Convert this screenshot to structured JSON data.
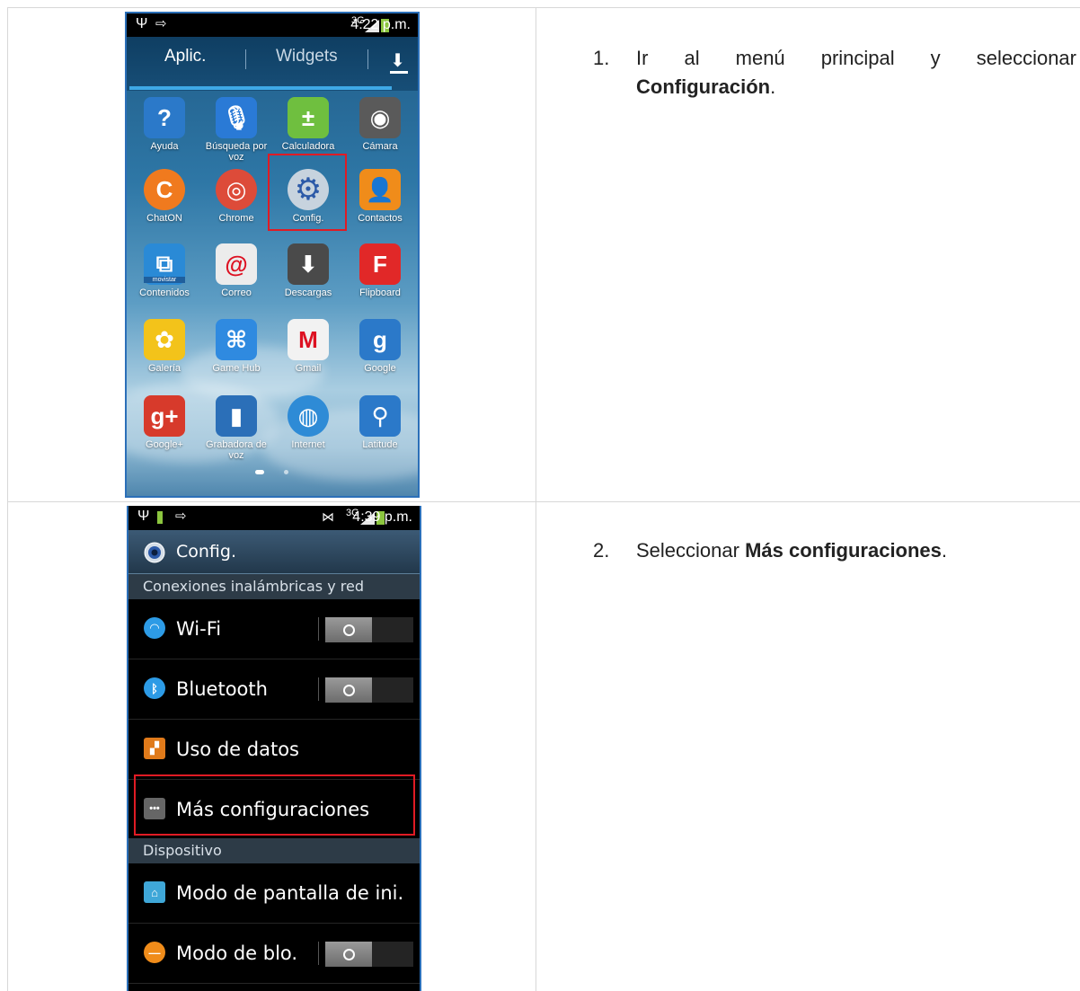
{
  "phone1": {
    "statusbar": {
      "net": "3G",
      "time": "4:22 p.m."
    },
    "tabs": {
      "apps": "Aplic.",
      "widgets": "Widgets"
    },
    "apps": [
      {
        "label": "Ayuda",
        "icon": "help-book-icon"
      },
      {
        "label": "Búsqueda por voz",
        "icon": "microphone-icon"
      },
      {
        "label": "Calculadora",
        "icon": "calculator-icon"
      },
      {
        "label": "Cámara",
        "icon": "camera-icon"
      },
      {
        "label": "ChatON",
        "icon": "chaton-icon"
      },
      {
        "label": "Chrome",
        "icon": "chrome-icon"
      },
      {
        "label": "Config.",
        "icon": "settings-gear-icon"
      },
      {
        "label": "Contactos",
        "icon": "contacts-icon"
      },
      {
        "label": "Contenidos",
        "icon": "movistar-contenidos-icon",
        "badge": "movistar"
      },
      {
        "label": "Correo",
        "icon": "email-icon"
      },
      {
        "label": "Descargas",
        "icon": "downloads-icon"
      },
      {
        "label": "Flipboard",
        "icon": "flipboard-icon"
      },
      {
        "label": "Galería",
        "icon": "gallery-icon"
      },
      {
        "label": "Game Hub",
        "icon": "gamepad-icon"
      },
      {
        "label": "Gmail",
        "icon": "gmail-icon"
      },
      {
        "label": "Google",
        "icon": "google-search-icon"
      },
      {
        "label": "Google+",
        "icon": "google-plus-icon"
      },
      {
        "label": "Grabadora de voz",
        "icon": "voice-recorder-icon"
      },
      {
        "label": "Internet",
        "icon": "internet-globe-icon"
      },
      {
        "label": "Latitude",
        "icon": "latitude-icon"
      }
    ]
  },
  "phone2": {
    "statusbar": {
      "net": "3G",
      "time": "4:39 p.m."
    },
    "header_title": "Config.",
    "section1": "Conexiones inalámbricas y red",
    "wifi": "Wi-Fi",
    "bluetooth": "Bluetooth",
    "data_usage": "Uso de datos",
    "more_settings": "Más configuraciones",
    "section2": "Dispositivo",
    "home_screen": "Modo de pantalla de ini.",
    "block_mode": "Modo de blo."
  },
  "steps": [
    {
      "num": "1.",
      "text": "Ir al menú principal y seleccionar",
      "bold": "Configuración",
      "after": "."
    },
    {
      "num": "2.",
      "text": "Seleccionar",
      "bold": "Más configuraciones",
      "after": "."
    }
  ],
  "colors": {
    "highlight": "#e01b24",
    "tab_accent": "#3ea8e6"
  }
}
